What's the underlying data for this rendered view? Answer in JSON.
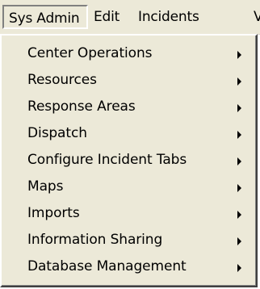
{
  "menubar": {
    "items": [
      {
        "label": "Sys Admin"
      },
      {
        "label": "Edit"
      },
      {
        "label": "Incidents"
      },
      {
        "label": "V"
      }
    ]
  },
  "sys_admin_menu": {
    "items": [
      {
        "label": "Center Operations"
      },
      {
        "label": "Resources"
      },
      {
        "label": "Response Areas"
      },
      {
        "label": "Dispatch"
      },
      {
        "label": "Configure Incident Tabs"
      },
      {
        "label": "Maps"
      },
      {
        "label": "Imports"
      },
      {
        "label": "Information Sharing"
      },
      {
        "label": "Database Management"
      }
    ]
  },
  "colors": {
    "menu_background": "#ece9d8",
    "text": "#000000"
  }
}
